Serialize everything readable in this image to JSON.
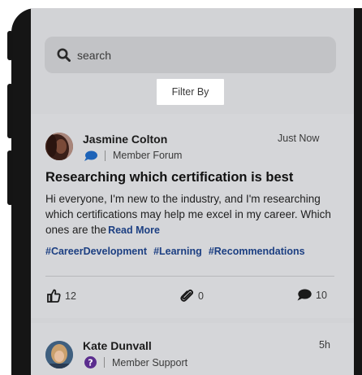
{
  "search": {
    "placeholder": "search",
    "icon": "search-icon"
  },
  "filter": {
    "label": "Filter By"
  },
  "posts": [
    {
      "author": "Jasmine Colton",
      "forum": "Member Forum",
      "forum_icon": "chat-bubble-icon",
      "time": "Just Now",
      "title": "Researching which certification is best",
      "body": "Hi everyone, I'm new to the industry, and I'm researching which certifications may help me excel in my career. Which ones are the",
      "read_more": "Read More",
      "tags": [
        "#CareerDevelopment",
        "#Learning",
        "#Recommendations"
      ],
      "likes": "12",
      "attachments": "0",
      "comments": "10"
    },
    {
      "author": "Kate Dunvall",
      "forum": "Member Support",
      "forum_icon": "question-icon",
      "time": "5h"
    }
  ],
  "colors": {
    "accent": "#1c3f82",
    "forum_icon": "#1d63b8",
    "support_icon": "#5b2d8e"
  }
}
